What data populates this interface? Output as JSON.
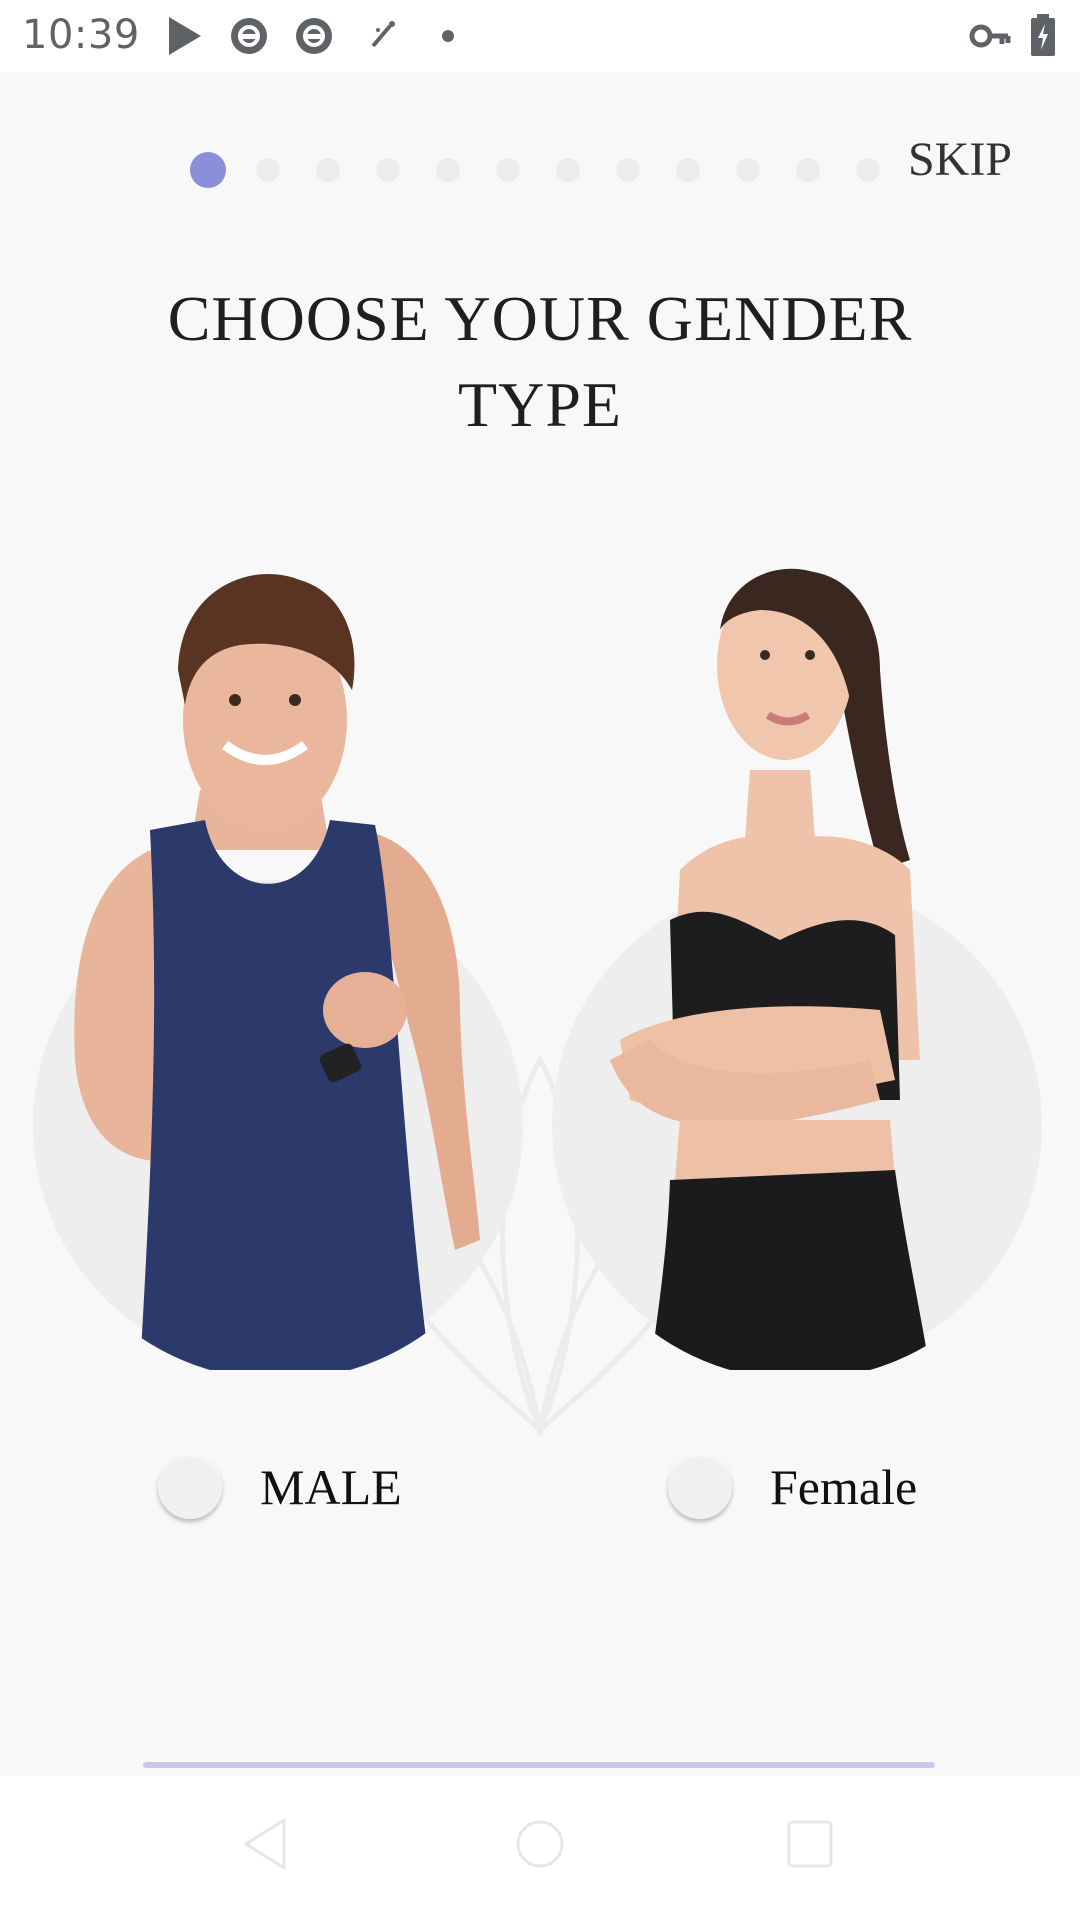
{
  "status_bar": {
    "time": "10:39",
    "icons": [
      "play-store-icon",
      "sync-icon",
      "sync-icon",
      "magic-wand-icon",
      "dot-icon",
      "vpn-key-icon",
      "battery-charging-icon"
    ]
  },
  "onboarding": {
    "pager_total": 12,
    "pager_active_index": 0,
    "skip_label": "SKIP",
    "title": "CHOOSE YOUR GENDER\nTYPE"
  },
  "options": {
    "male_label": "MALE",
    "female_label": "Female"
  },
  "nav_bar": {
    "buttons": [
      "back-icon",
      "home-icon",
      "recents-icon"
    ]
  },
  "colors": {
    "accent": "#8b8fd9",
    "background": "#f8f8f8"
  }
}
